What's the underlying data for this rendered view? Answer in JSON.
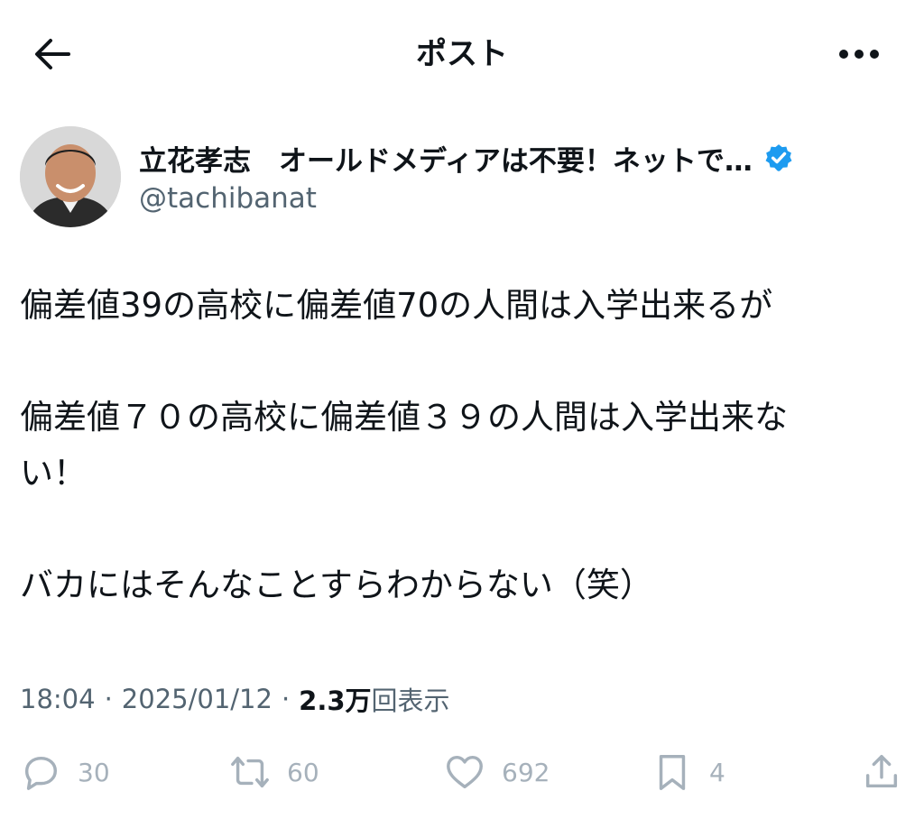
{
  "header": {
    "back_icon": "arrow-left-icon",
    "title": "ポスト",
    "more_icon": "more-horizontal-icon"
  },
  "author": {
    "display_name": "立花孝志　オールドメディアは不要！ネットで…",
    "handle": "@tachibanat",
    "verified": true,
    "verified_color": "#1d9bf0"
  },
  "post": {
    "lines": [
      "偏差値39の高校に偏差値70の人間は入学出来るが",
      "",
      "偏差値７０の高校に偏差値３９の人間は入学出来な",
      "い！",
      "",
      "バカにはそんなことすらわからない（笑）"
    ]
  },
  "meta": {
    "time": "18:04",
    "date": "2025/01/12",
    "views_count": "2.3万",
    "views_label": "回表示",
    "separator": "·"
  },
  "actions": {
    "reply_count": "30",
    "repost_count": "60",
    "like_count": "692",
    "bookmark_count": "4"
  },
  "colors": {
    "text": "#0f1419",
    "secondary": "#536471",
    "icon_muted": "#a6b1bb"
  }
}
